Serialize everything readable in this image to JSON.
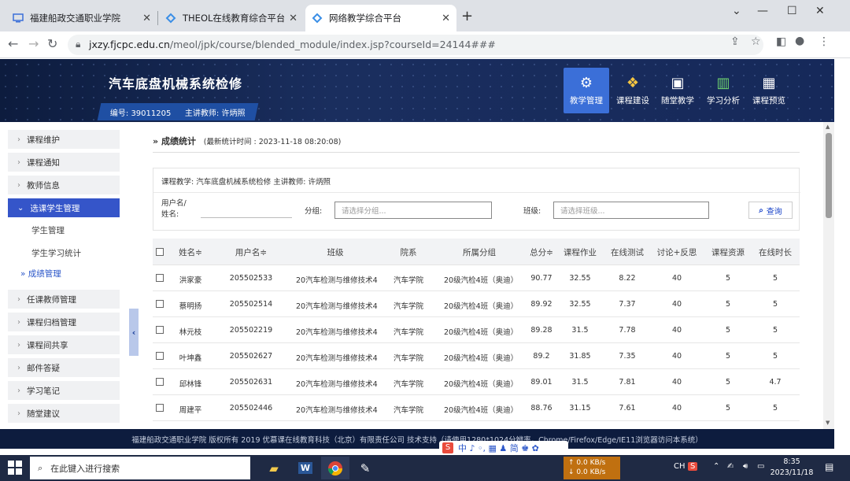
{
  "browser": {
    "tabs": [
      {
        "title": "福建船政交通职业学院",
        "active": false
      },
      {
        "title": "THEOL在线教育综合平台-福建船",
        "active": false
      },
      {
        "title": "网络教学综合平台",
        "active": true
      }
    ],
    "new_tab": "+",
    "url_host": "jxzy.fjcpc.edu.cn",
    "url_path": "/meol/jpk/course/blended_module/index.jsp?courseId=24144###",
    "window_min": "—",
    "window_max": "☐",
    "window_close": "✕",
    "tab_dropdown": "⌄"
  },
  "header": {
    "course_title": "汽车底盘机械系统检修",
    "course_code_label": "编号: 39011205",
    "teacher_label": "主讲教师: 许炳照",
    "nav": [
      {
        "label": "教学管理",
        "icon": "gear-icon",
        "glyph": "⚙",
        "active": true
      },
      {
        "label": "课程建设",
        "icon": "cubes-icon",
        "glyph": "❖",
        "active": false
      },
      {
        "label": "随堂教学",
        "icon": "classroom-icon",
        "glyph": "▣",
        "active": false
      },
      {
        "label": "学习分析",
        "icon": "chart-icon",
        "glyph": "▥",
        "active": false
      },
      {
        "label": "课程预览",
        "icon": "preview-icon",
        "glyph": "▦",
        "active": false
      }
    ]
  },
  "sidebar": {
    "items": [
      {
        "label": "课程维护",
        "arrow": "›"
      },
      {
        "label": "课程通知",
        "arrow": "›"
      },
      {
        "label": "教师信息",
        "arrow": "›"
      },
      {
        "label": "选课学生管理",
        "arrow": "⌄",
        "open": true
      },
      {
        "label": "任课教师管理",
        "arrow": "›"
      },
      {
        "label": "课程归档管理",
        "arrow": "›"
      },
      {
        "label": "课程间共享",
        "arrow": "›"
      },
      {
        "label": "邮件答疑",
        "arrow": "›"
      },
      {
        "label": "学习笔记",
        "arrow": "›"
      },
      {
        "label": "随堂建议",
        "arrow": "›"
      }
    ],
    "subitems": [
      {
        "label": "学生管理"
      },
      {
        "label": "学生学习统计"
      },
      {
        "label": "» 成绩管理",
        "current": true
      }
    ],
    "collapse_glyph": "‹"
  },
  "main": {
    "breadcrumb_prefix": "»",
    "breadcrumb": "成绩统计",
    "stat_time": "(最新统计时间 : 2023-11-18 08:20:08)",
    "course_info": "课程教学: 汽车底盘机械系统检修    主讲教师: 许炳照",
    "filter": {
      "username_label_1": "用户名/",
      "username_label_2": "姓名:",
      "group_label": "分组:",
      "group_placeholder": "请选择分组...",
      "class_label": "班级:",
      "class_placeholder": "请选择班级...",
      "query_button": "查询"
    },
    "table": {
      "headers": [
        "姓名≑",
        "用户名≑",
        "班级",
        "院系",
        "所属分组",
        "总分≑",
        "课程作业",
        "在线测试",
        "讨论+反思",
        "课程资源",
        "在线时长"
      ],
      "rows": [
        [
          "洪家豪",
          "205502533",
          "20汽车检测与维修技术4",
          "汽车学院",
          "20级汽检4班（奥迪）",
          "90.77",
          "32.55",
          "8.22",
          "40",
          "5",
          "5"
        ],
        [
          "蔡明扬",
          "205502514",
          "20汽车检测与维修技术4",
          "汽车学院",
          "20级汽检4班（奥迪）",
          "89.92",
          "32.55",
          "7.37",
          "40",
          "5",
          "5"
        ],
        [
          "林元枝",
          "205502219",
          "20汽车检测与维修技术4",
          "汽车学院",
          "20级汽检4班（奥迪）",
          "89.28",
          "31.5",
          "7.78",
          "40",
          "5",
          "5"
        ],
        [
          "叶坤鑫",
          "205502627",
          "20汽车检测与维修技术4",
          "汽车学院",
          "20级汽检4班（奥迪）",
          "89.2",
          "31.85",
          "7.35",
          "40",
          "5",
          "5"
        ],
        [
          "邱林锋",
          "205502631",
          "20汽车检测与维修技术4",
          "汽车学院",
          "20级汽检4班（奥迪）",
          "89.01",
          "31.5",
          "7.81",
          "40",
          "5",
          "4.7"
        ],
        [
          "周建平",
          "205502446",
          "20汽车检测与维修技术4",
          "汽车学院",
          "20级汽检4班（奥迪）",
          "88.76",
          "31.15",
          "7.61",
          "40",
          "5",
          "5"
        ]
      ]
    }
  },
  "footer": {
    "text": "福建船政交通职业学院 版权所有 2019 优慕课在线教育科技（北京）有限责任公司 技术支持（请使用1280*1024分辨率，Chrome/Firefox/Edge/IE11浏览器访问本系统）",
    "ime_s": "S",
    "ime_text": "中 ♪ ◦, ▦ ♟ 简 ♚ ✿"
  },
  "taskbar": {
    "search_placeholder": "在此键入进行搜索",
    "net_up": "↑ 0.0 KB/s",
    "net_down": "↓ 0.0 KB/s",
    "lang": "CH",
    "ime_tray": "S",
    "time": "8:35",
    "date": "2023/11/18"
  }
}
